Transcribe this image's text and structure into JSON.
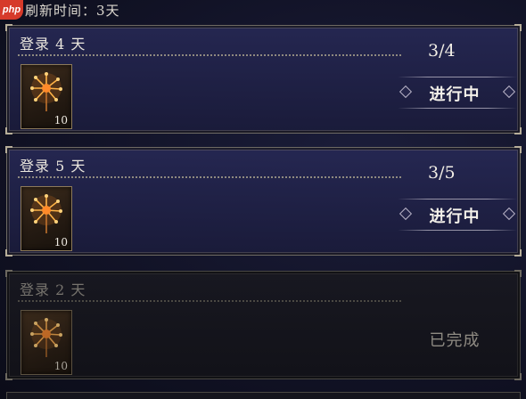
{
  "watermark": "php",
  "refresh_text": "刷新时间：3天",
  "tasks": [
    {
      "title": "登录 4 天",
      "progress": "3/4",
      "status": "进行中",
      "reward": {
        "icon": "firework-icon",
        "qty": "10"
      }
    },
    {
      "title": "登录 5 天",
      "progress": "3/5",
      "status": "进行中",
      "reward": {
        "icon": "firework-icon",
        "qty": "10"
      }
    },
    {
      "title": "登录 2 天",
      "progress": "",
      "status": "已完成",
      "reward": {
        "icon": "firework-icon",
        "qty": "10"
      }
    }
  ]
}
